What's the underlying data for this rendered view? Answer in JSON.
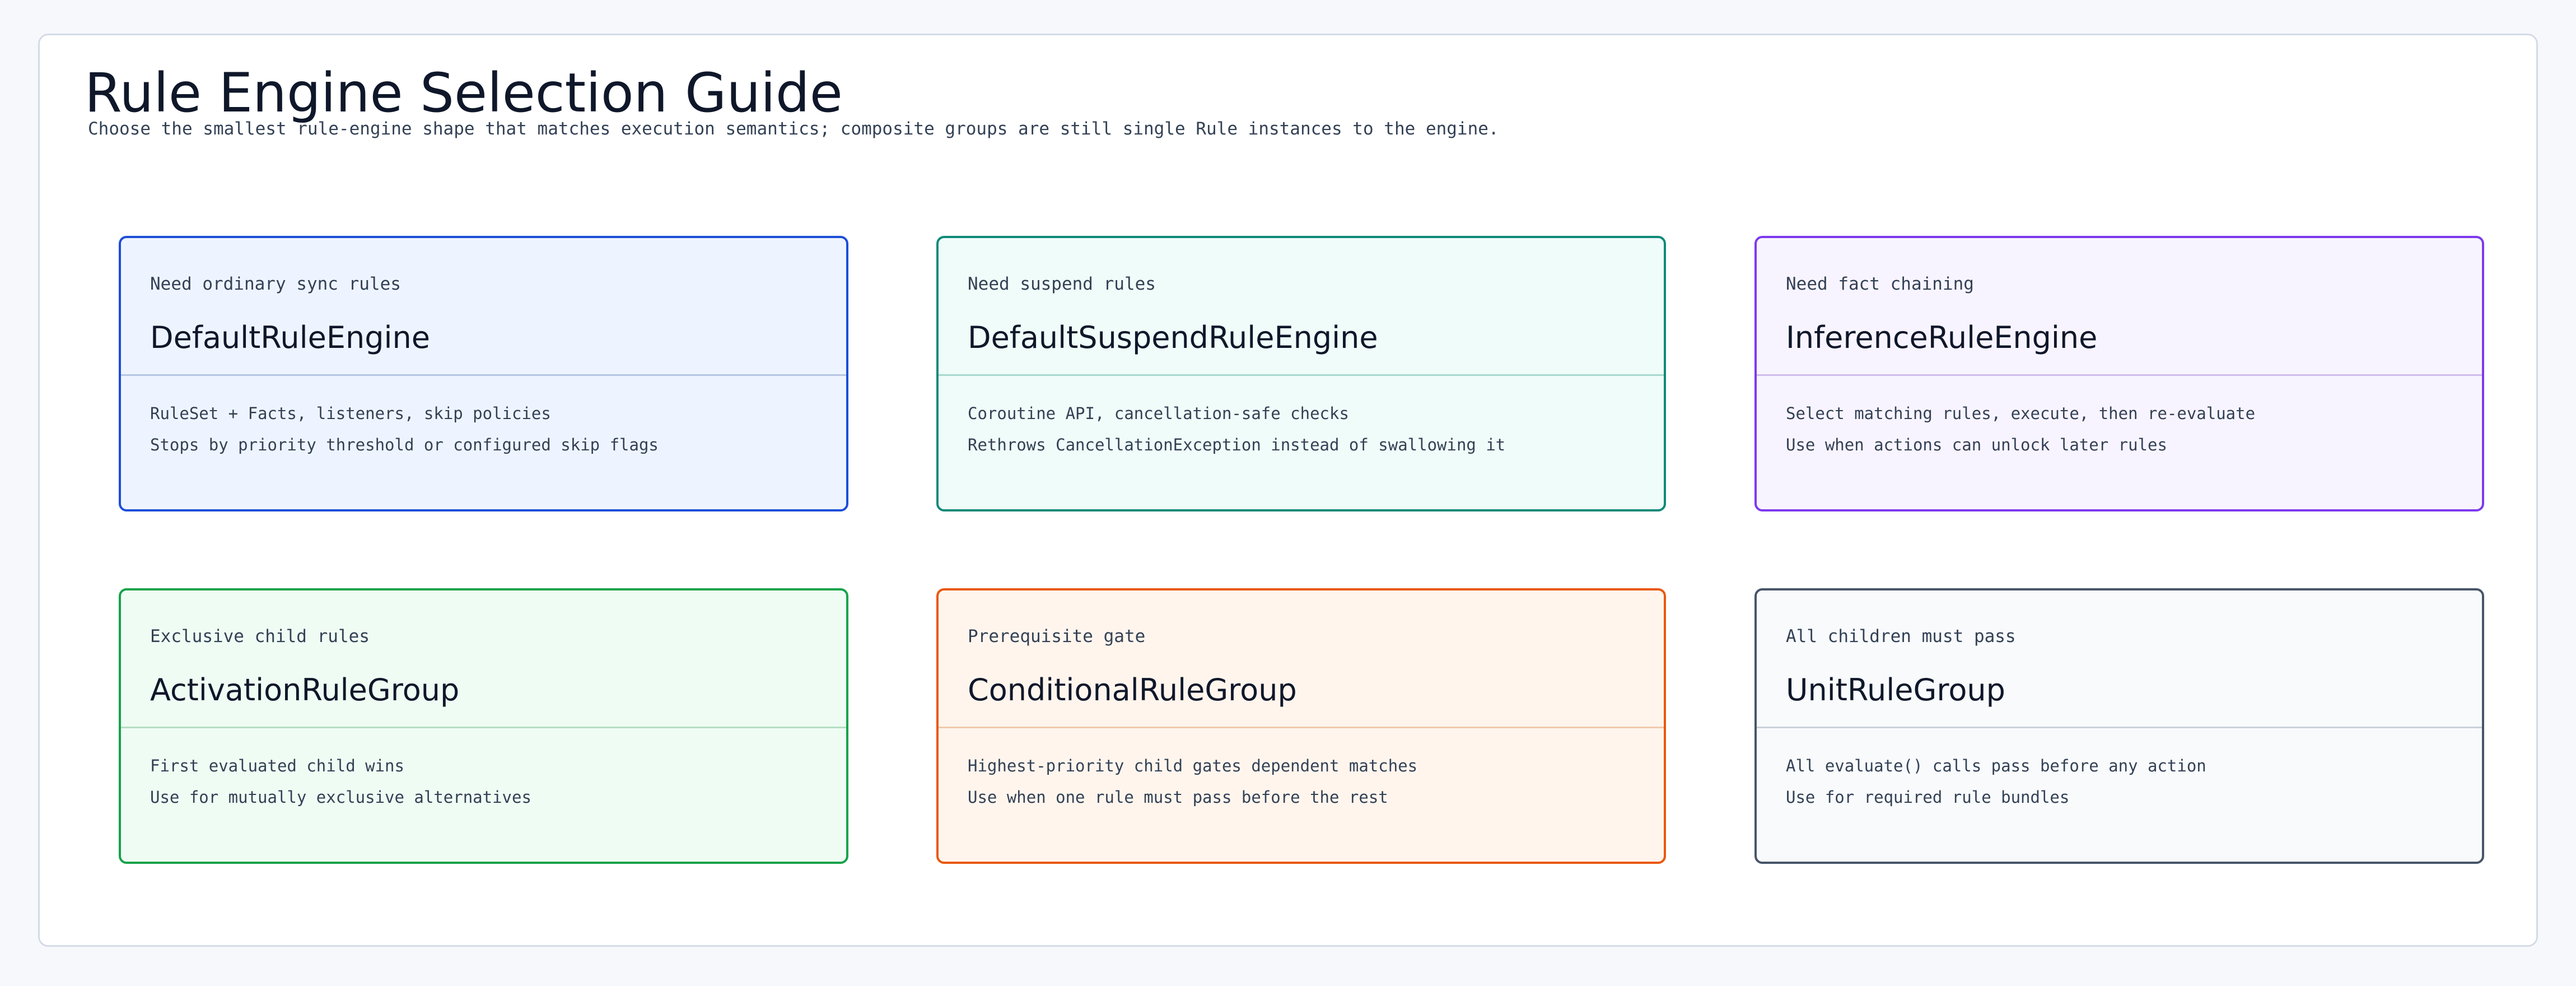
{
  "page": {
    "title": "Rule Engine Selection Guide",
    "subtitle": "Choose the smallest rule-engine shape that matches execution semantics; composite groups are still single Rule instances to the engine."
  },
  "cards": [
    {
      "eyebrow": "Need ordinary sync rules",
      "name": "DefaultRuleEngine",
      "lines": [
        "RuleSet + Facts, listeners, skip policies",
        "Stops by priority threshold or configured skip flags"
      ],
      "border_color": "#1d4ed8",
      "fill_color": "#eef4ff",
      "divider_color": "#b6c6e3"
    },
    {
      "eyebrow": "Need suspend rules",
      "name": "DefaultSuspendRuleEngine",
      "lines": [
        "Coroutine API, cancellation-safe checks",
        "Rethrows CancellationException instead of swallowing it"
      ],
      "border_color": "#0f8a7a",
      "fill_color": "#effcf9",
      "divider_color": "#a7d8cf"
    },
    {
      "eyebrow": "Need fact chaining",
      "name": "InferenceRuleEngine",
      "lines": [
        "Select matching rules, execute, then re-evaluate",
        "Use when actions can unlock later rules"
      ],
      "border_color": "#7c3aed",
      "fill_color": "#f8f4ff",
      "divider_color": "#cdbcec"
    },
    {
      "eyebrow": "Exclusive child rules",
      "name": "ActivationRuleGroup",
      "lines": [
        "First evaluated child wins",
        "Use for mutually exclusive alternatives"
      ],
      "border_color": "#16a34a",
      "fill_color": "#effcf3",
      "divider_color": "#b3dec2"
    },
    {
      "eyebrow": "Prerequisite gate",
      "name": "ConditionalRuleGroup",
      "lines": [
        "Highest-priority child gates dependent matches",
        "Use when one rule must pass before the rest"
      ],
      "border_color": "#ea580c",
      "fill_color": "#fff5ed",
      "divider_color": "#f1c9ad"
    },
    {
      "eyebrow": "All children must pass",
      "name": "UnitRuleGroup",
      "lines": [
        "All evaluate() calls pass before any action",
        "Use for required rule bundles"
      ],
      "border_color": "#475569",
      "fill_color": "#f8fafc",
      "divider_color": "#c8d0da"
    }
  ]
}
